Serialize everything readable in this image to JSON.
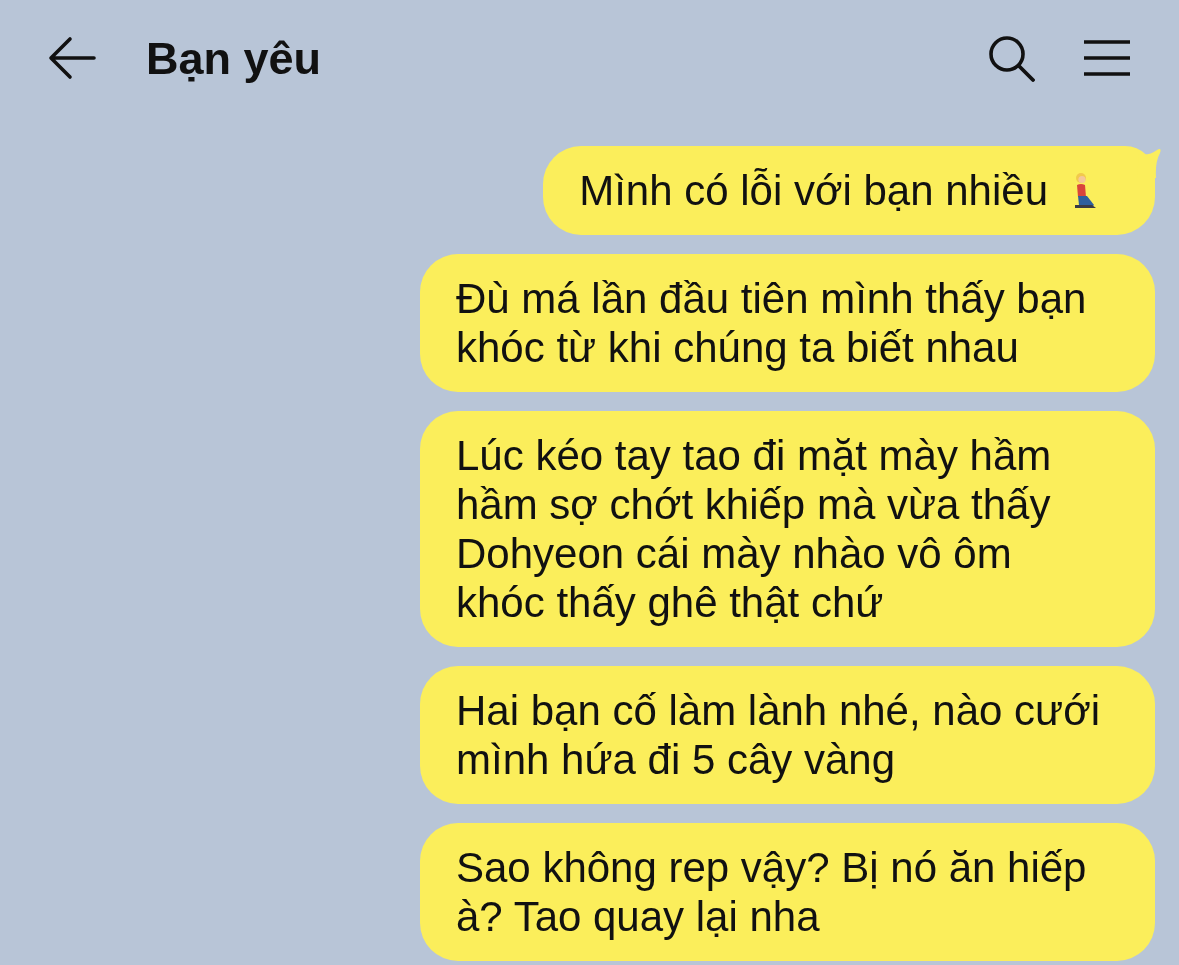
{
  "header": {
    "title": "Bạn yêu"
  },
  "messages": [
    {
      "lines": [
        "Mình có lỗi với bạn nhiều"
      ],
      "tail": true,
      "emoji": true
    },
    {
      "lines": [
        "Đù má lần đầu tiên mình thấy bạn",
        "khóc từ khi chúng ta biết nhau"
      ],
      "tail": false,
      "emoji": false
    },
    {
      "lines": [
        "Lúc kéo tay tao đi mặt mày hầm",
        "hầm sợ chớt khiếp mà vừa thấy",
        "Dohyeon cái mày nhào vô ôm",
        "khóc thấy ghê thật chứ"
      ],
      "tail": false,
      "emoji": false
    },
    {
      "lines": [
        "Hai bạn cố làm lành nhé, nào cưới",
        "mình hứa đi 5 cây vàng"
      ],
      "tail": false,
      "emoji": false
    },
    {
      "lines": [
        "Sao không rep vậy? Bị nó ăn hiếp",
        "à? Tao quay lại nha"
      ],
      "tail": false,
      "emoji": false
    }
  ]
}
